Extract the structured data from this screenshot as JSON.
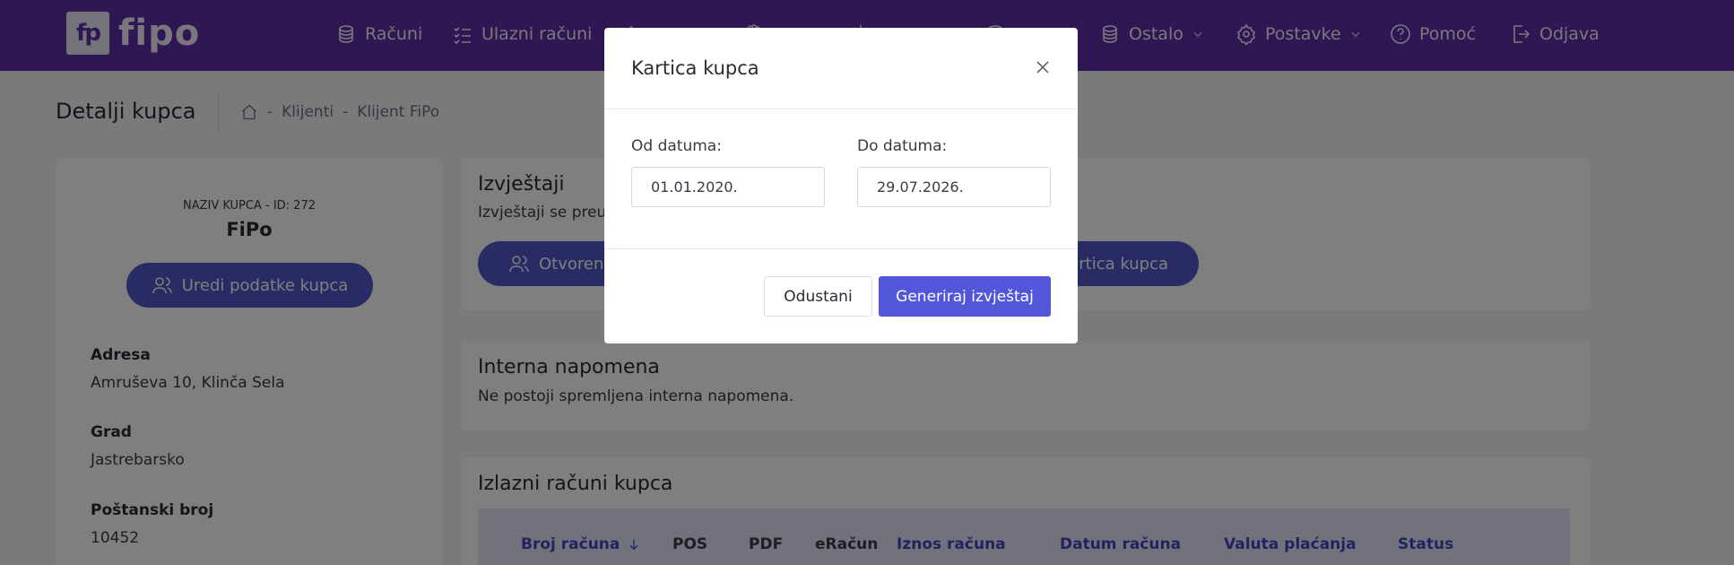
{
  "nav": {
    "logo_mark": "fp",
    "logo_text": "fipo",
    "items": [
      {
        "label": "Računi",
        "icon": "coins-icon"
      },
      {
        "label": "Ulazni računi",
        "icon": "checklist-icon"
      },
      {
        "label": "",
        "icon": "tools-icon"
      },
      {
        "label": "",
        "icon": "hand-icon"
      },
      {
        "label": "",
        "icon": "gear-people-icon"
      },
      {
        "label": "",
        "icon": "database-icon"
      },
      {
        "label": "Ostalo",
        "icon": "database-icon"
      },
      {
        "label": "Postavke",
        "icon": "gear-icon"
      },
      {
        "label": "Pomoć",
        "icon": "help-circle-icon"
      },
      {
        "label": "Odjava",
        "icon": "logout-icon"
      }
    ]
  },
  "header": {
    "title": "Detalji kupca",
    "breadcrumb": [
      "Klijenti",
      "Klijent FiPo"
    ]
  },
  "customer": {
    "caption": "NAZIV KUPCA - ID: 272",
    "name": "FiPo",
    "edit_button": "Uredi podatke kupca",
    "fields": [
      {
        "label": "Adresa",
        "value": "Amruševa 10, Klinča Sela"
      },
      {
        "label": "Grad",
        "value": "Jastrebarsko"
      },
      {
        "label": "Poštanski broj",
        "value": "10452"
      }
    ]
  },
  "reports": {
    "title": "Izvještaji",
    "subtitle": "Izvještaji se preuz",
    "buttons": [
      "Otvoreni",
      "rtica kupca"
    ]
  },
  "note": {
    "title": "Interna napomena",
    "text": "Ne postoji spremljena interna napomena."
  },
  "invoices": {
    "title": "Izlazni računi kupca",
    "columns": [
      {
        "label": "Broj računa",
        "sortable": true
      },
      {
        "label": "POS",
        "sortable": false
      },
      {
        "label": "PDF",
        "sortable": false
      },
      {
        "label": "eRačun",
        "sortable": false
      },
      {
        "label": "Iznos računa",
        "sortable": true
      },
      {
        "label": "Datum računa",
        "sortable": true
      },
      {
        "label": "Valuta plaćanja",
        "sortable": true
      },
      {
        "label": "Status",
        "sortable": true
      }
    ]
  },
  "modal": {
    "title": "Kartica kupca",
    "from_label": "Od datuma:",
    "from_value": "01.01.2020.",
    "to_label": "Do datuma:",
    "to_value": "29.07.2026.",
    "cancel_label": "Odustani",
    "generate_label": "Generiraj izvještaj"
  },
  "colors": {
    "nav_bg": "#5c2ea6",
    "primary": "#5256c8",
    "overlay": "rgba(0,0,0,0.5)"
  }
}
